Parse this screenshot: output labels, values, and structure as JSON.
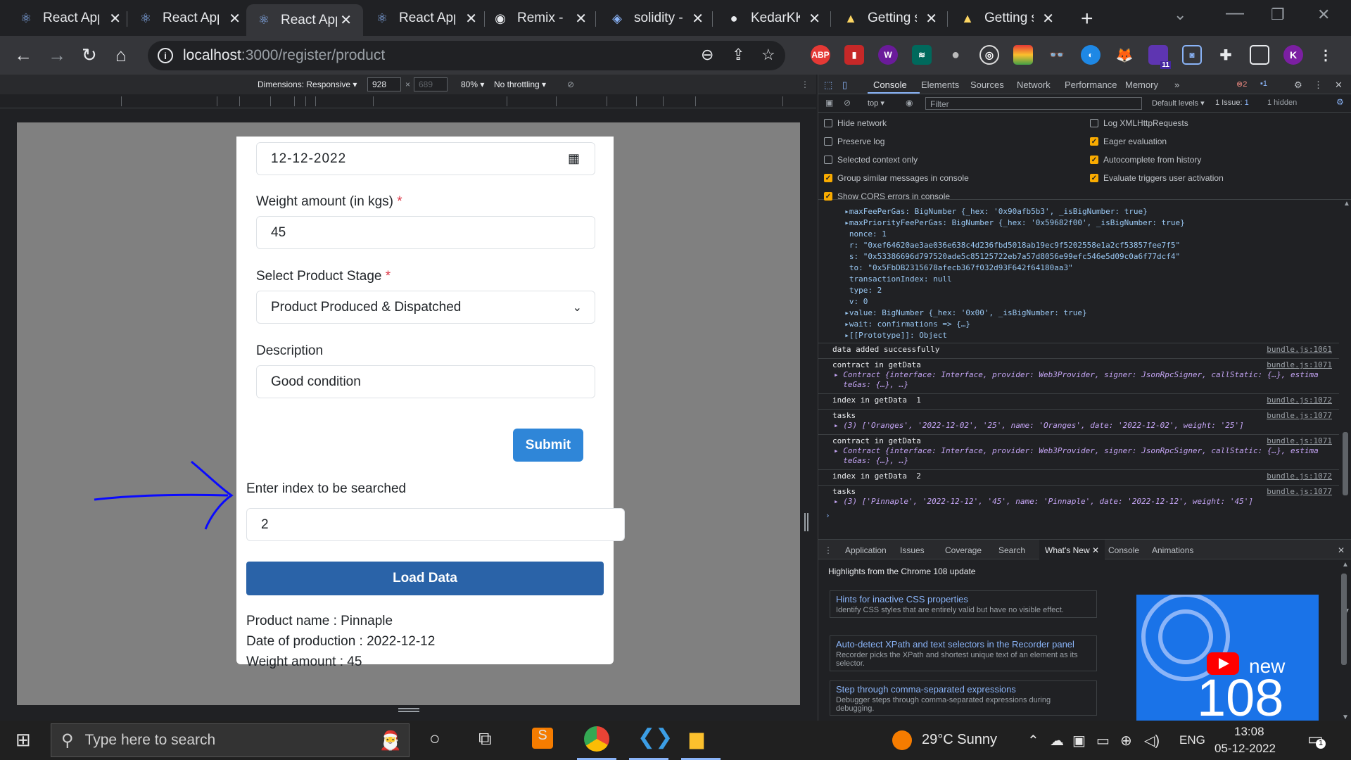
{
  "tabs": [
    {
      "title": "React App",
      "icon": "react-icon"
    },
    {
      "title": "React App",
      "icon": "react-icon"
    },
    {
      "title": "React App",
      "icon": "react-icon"
    },
    {
      "title": "React App",
      "icon": "react-icon"
    },
    {
      "title": "Remix - E",
      "icon": "remix-icon"
    },
    {
      "title": "solidity -",
      "icon": "solidity-icon"
    },
    {
      "title": "KedarKK",
      "icon": "github-icon"
    },
    {
      "title": "Getting s",
      "icon": "warning-icon"
    },
    {
      "title": "Getting s",
      "icon": "warning-icon"
    }
  ],
  "url": {
    "host": "localhost",
    "path": ":3000/register/product"
  },
  "devbar": {
    "dimensions": "Dimensions: Responsive ▾",
    "width": "928",
    "height": "689",
    "zoom": "80% ▾",
    "throttle": "No throttling ▾"
  },
  "form": {
    "date_value": "12-12-2022",
    "weight_label": "Weight amount (in kgs)",
    "weight_value": "45",
    "stage_label": "Select Product Stage",
    "stage_value": "Product Produced & Dispatched",
    "desc_label": "Description",
    "desc_value": "Good condition",
    "submit": "Submit",
    "req": "*"
  },
  "search": {
    "label": "Enter index to be searched",
    "value": "2",
    "button": "Load Data"
  },
  "result": {
    "name": "Product name : Pinnaple",
    "date": "Date of production : 2022-12-12",
    "weight": "Weight amount : 45"
  },
  "devtools": {
    "tabs": [
      "Console",
      "Elements",
      "Sources",
      "Network",
      "Performance",
      "Memory",
      "»"
    ],
    "errors": "2",
    "messages": "1",
    "context": "top ▾",
    "filter": "Filter",
    "levels": "Default levels ▾",
    "issues": "1 Issue: ",
    "issues_count": "1",
    "hidden": "1 hidden",
    "options_left": [
      "Hide network",
      "Preserve log",
      "Selected context only",
      "Group similar messages in console",
      "Show CORS errors in console"
    ],
    "options_left_checked": [
      false,
      false,
      false,
      true,
      true
    ],
    "options_right": [
      "Log XMLHttpRequests",
      "Eager evaluation",
      "Autocomplete from history",
      "Evaluate triggers user activation"
    ],
    "options_right_checked": [
      false,
      true,
      true,
      true
    ]
  },
  "console": {
    "obj_lines": [
      "  ▸maxFeePerGas: BigNumber {_hex: '0x90afb5b3', _isBigNumber: true}",
      "  ▸maxPriorityFeePerGas: BigNumber {_hex: '0x59682f00', _isBigNumber: true}",
      "   nonce: 1",
      "   r: \"0xef64620ae3ae036e638c4d236fbd5018ab19ec9f5202558e1a2cf53857fee7f5\"",
      "   s: \"0x53386696d797520ade5c85125722eb7a57d8056e99efc546e5d09c0a6f77dcf4\"",
      "   to: \"0x5FbDB2315678afecb367f032d93F642f64180aa3\"",
      "   transactionIndex: null",
      "   type: 2",
      "   v: 0",
      "  ▸value: BigNumber {_hex: '0x00', _isBigNumber: true}",
      "  ▸wait: confirmations => {…}",
      "  ▸[[Prototype]]: Object"
    ],
    "entries": [
      {
        "text": "data added successfully",
        "src": "bundle.js:1061"
      },
      {
        "text": "contract in getData",
        "sub": "▸ Contract {interface: Interface, provider: Web3Provider, signer: JsonRpcSigner, callStatic: {…}, estima\n  teGas: {…}, …}",
        "src": "bundle.js:1071"
      },
      {
        "text": "index in getData  1",
        "src": "bundle.js:1072"
      },
      {
        "text": "tasks",
        "sub": "▸ (3) ['Oranges', '2022-12-02', '25', name: 'Oranges', date: '2022-12-02', weight: '25']",
        "src": "bundle.js:1077"
      },
      {
        "text": "contract in getData",
        "sub": "▸ Contract {interface: Interface, provider: Web3Provider, signer: JsonRpcSigner, callStatic: {…}, estima\n  teGas: {…}, …}",
        "src": "bundle.js:1071"
      },
      {
        "text": "index in getData  2",
        "src": "bundle.js:1072"
      },
      {
        "text": "tasks",
        "sub": "▸ (3) ['Pinnaple', '2022-12-12', '45', name: 'Pinnaple', date: '2022-12-12', weight: '45']",
        "src": "bundle.js:1077"
      }
    ]
  },
  "drawer": {
    "tabs": [
      "Application",
      "Issues",
      "Coverage",
      "Search",
      "What's New",
      "Console",
      "Animations"
    ],
    "highlight": "Highlights from the Chrome 108 update",
    "items": [
      {
        "title": "Hints for inactive CSS properties",
        "desc": "Identify CSS styles that are entirely valid but have no visible effect."
      },
      {
        "title": "Auto-detect XPath and text selectors in the Recorder panel",
        "desc": "Recorder picks the XPath and shortest unique text of an element as its selector."
      },
      {
        "title": "Step through comma-separated expressions",
        "desc": "Debugger steps through comma-separated expressions during debugging."
      }
    ],
    "video_new": "new",
    "video_num": "108"
  },
  "taskbar": {
    "search": "Type here to search",
    "weather": "29°C  Sunny",
    "lang": "ENG",
    "time": "13:08",
    "date": "05-12-2022",
    "notif": "1"
  },
  "colors": {
    "primary": "#2f86d8",
    "load": "#2a63a8",
    "annotation": "#0a0aff"
  }
}
